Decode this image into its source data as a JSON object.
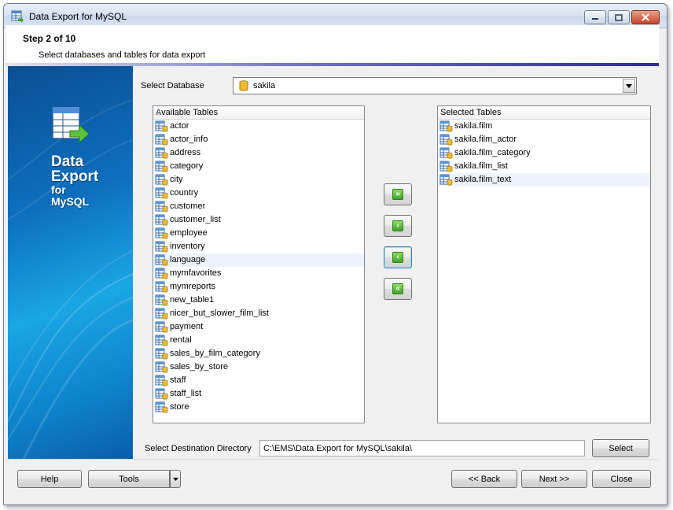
{
  "window": {
    "title": "Data Export for MySQL"
  },
  "header": {
    "step": "Step 2 of 10",
    "subtitle": "Select databases and tables for data export"
  },
  "sidebar": {
    "line1": "Data",
    "line2": "Export",
    "line3": "for",
    "line4": "MySQL"
  },
  "database": {
    "label": "Select Database",
    "value": "sakila"
  },
  "available": {
    "header": "Available Tables",
    "sort_glyph": "△",
    "items": [
      "actor",
      "actor_info",
      "address",
      "category",
      "city",
      "country",
      "customer",
      "customer_list",
      "employee",
      "inventory",
      "language",
      "mymfavorites",
      "mymreports",
      "new_table1",
      "nicer_but_slower_film_list",
      "payment",
      "rental",
      "sales_by_film_category",
      "sales_by_store",
      "staff",
      "staff_list",
      "store"
    ],
    "highlighted": "language"
  },
  "selected": {
    "header": "Selected Tables",
    "items": [
      "sakila.film",
      "sakila.film_actor",
      "sakila.film_category",
      "sakila.film_list",
      "sakila.film_text"
    ],
    "highlighted": "sakila.film_text"
  },
  "move_buttons": {
    "add_all": "»",
    "add": "›",
    "remove": "‹",
    "remove_all": "«"
  },
  "destination": {
    "label": "Select Destination Directory",
    "value": "C:\\EMS\\Data Export for MySQL\\sakila\\",
    "button": "Select"
  },
  "footer": {
    "help": "Help",
    "tools": "Tools",
    "back": "<< Back",
    "next": "Next >>",
    "close": "Close"
  },
  "colors": {
    "accent_gradient_end": "#2d2f87",
    "sidebar_blue": "#0d6fbf",
    "move_arrow_green": "#3fa22a"
  }
}
